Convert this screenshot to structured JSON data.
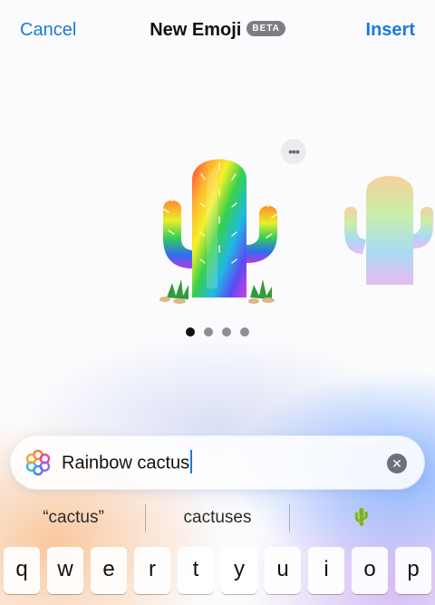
{
  "nav": {
    "cancel_label": "Cancel",
    "title": "New Emoji",
    "badge": "BETA",
    "insert_label": "Insert"
  },
  "carousel": {
    "page_count": 4,
    "active_index": 0,
    "emoji_description_icon": "rainbow-cactus-emoji"
  },
  "prompt": {
    "value": "Rainbow cactus"
  },
  "suggestions": [
    "“cactus”",
    "cactuses",
    "🌵"
  ],
  "keyboard": {
    "row1": [
      "q",
      "w",
      "e",
      "r",
      "t",
      "y",
      "u",
      "i",
      "o",
      "p"
    ]
  },
  "colors": {
    "accent": "#1a7ad9",
    "badge": "#7d7d84"
  }
}
